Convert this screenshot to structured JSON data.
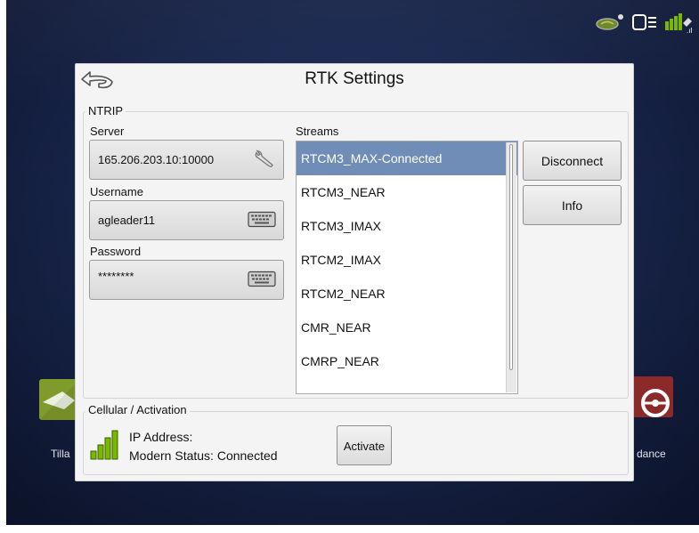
{
  "dialog": {
    "title": "RTK Settings",
    "ntrip_label": "NTRIP",
    "server": {
      "label": "Server",
      "value": "165.206.203.10:10000"
    },
    "username": {
      "label": "Username",
      "value": "agleader11"
    },
    "password": {
      "label": "Password",
      "value": "********"
    },
    "streams": {
      "label": "Streams",
      "items": [
        "RTCM3_MAX-Connected",
        "RTCM3_NEAR",
        "RTCM3_IMAX",
        "RTCM2_IMAX",
        "RTCM2_NEAR",
        "CMR_NEAR",
        "CMRP_NEAR"
      ],
      "selected_index": 0
    },
    "buttons": {
      "disconnect": "Disconnect",
      "info": "Info"
    },
    "cellular": {
      "label": "Cellular / Activation",
      "ip_address": "IP Address:",
      "modem_status": "Modern Status: Connected",
      "activate": "Activate"
    }
  },
  "background": {
    "left_label": "Tilla",
    "right_label": "dance"
  },
  "colors": {
    "selected_row": "#6f8db7",
    "signal_green": "#7ab800",
    "screen_bg": "#1a2850"
  }
}
